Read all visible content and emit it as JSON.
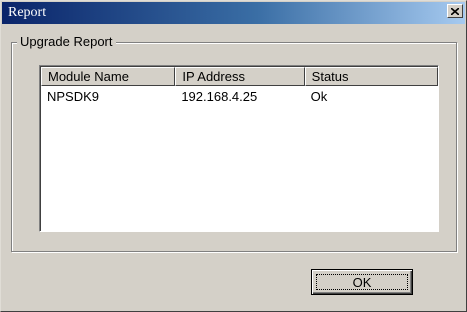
{
  "window": {
    "title": "Report",
    "close_glyph": "close-icon"
  },
  "group": {
    "label": "Upgrade Report"
  },
  "list": {
    "columns": [
      "Module Name",
      "IP Address",
      "Status"
    ],
    "rows": [
      [
        "NPSDK9",
        "192.168.4.25",
        "Ok"
      ]
    ]
  },
  "buttons": {
    "ok_label": "OK"
  },
  "colors": {
    "titlebar_start": "#0a246a",
    "titlebar_end": "#a6caf0",
    "face": "#d4d0c8"
  }
}
